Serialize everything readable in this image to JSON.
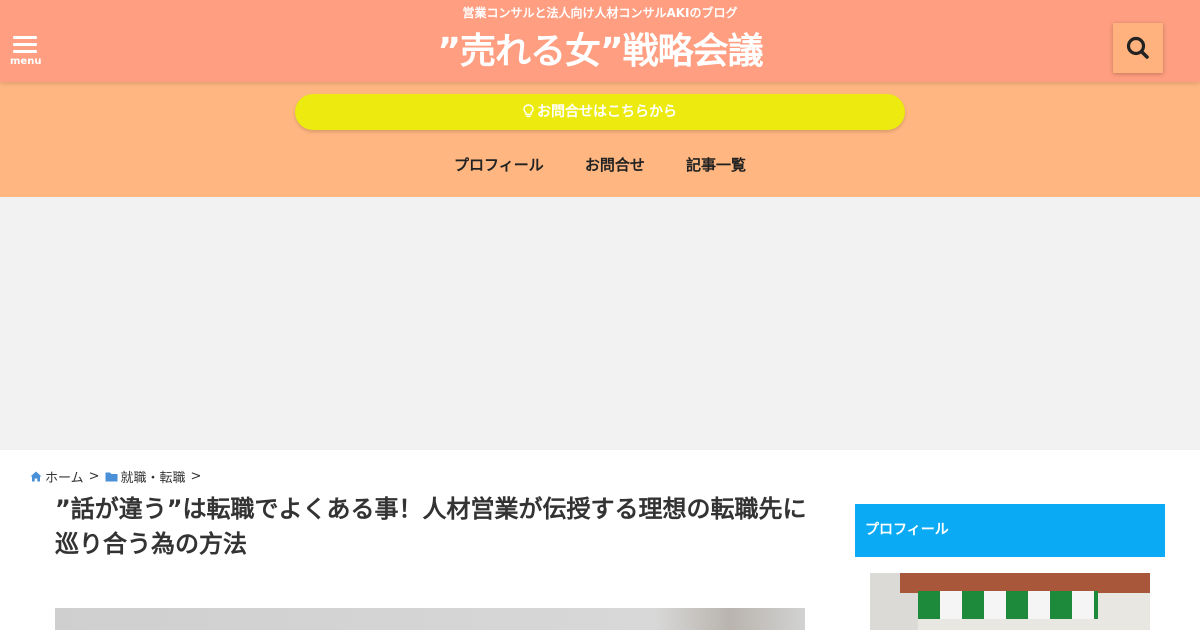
{
  "header": {
    "tagline": "営業コンサルと法人向け人材コンサルAKIのブログ",
    "site_title": "”売れる女”戦略会議",
    "menu_label": "menu",
    "menu_icon": "hamburger-icon",
    "search_icon": "search-icon",
    "bg_color": "#ff9e80"
  },
  "nav": {
    "contact_button": "お問合せはこちらから",
    "contact_icon": "lightbulb-icon",
    "links": [
      "プロフィール",
      "お問合せ",
      "記事一覧"
    ],
    "bg_color": "#ffb680",
    "button_color": "#ecea0f"
  },
  "breadcrumb": {
    "home": "ホーム",
    "home_icon": "home-icon",
    "category": "就職・転職",
    "category_icon": "folder-icon",
    "separator": ">"
  },
  "article": {
    "title": "”話が違う”は転職でよくある事！人材営業が伝授する理想の転職先に巡り合う為の方法"
  },
  "sidebar": {
    "profile_heading": "プロフィール",
    "heading_color": "#0baaf4"
  }
}
